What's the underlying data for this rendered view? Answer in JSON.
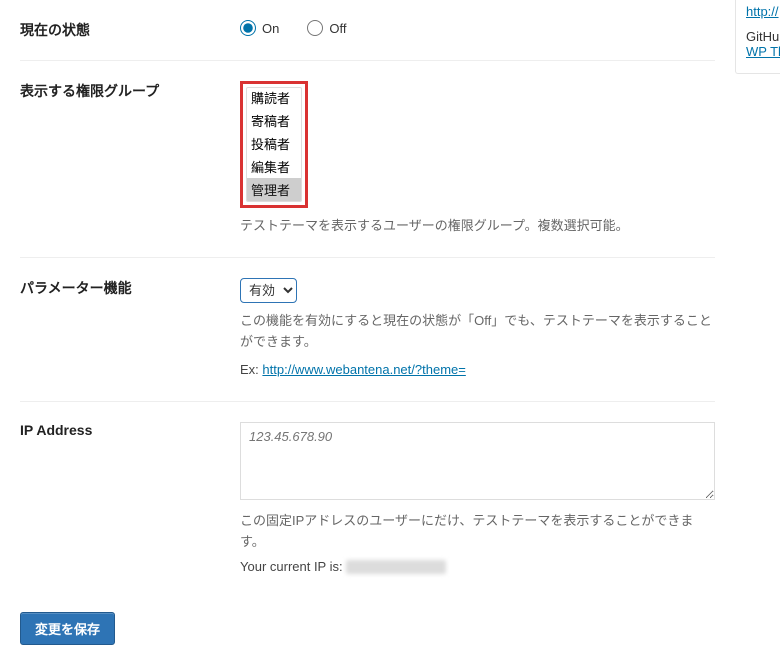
{
  "rows": {
    "status": {
      "label": "現在の状態",
      "on": "On",
      "off": "Off"
    },
    "groups": {
      "label": "表示する権限グループ",
      "options": [
        "購読者",
        "寄稿者",
        "投稿者",
        "編集者",
        "管理者"
      ],
      "selected": "管理者",
      "desc": "テストテーマを表示するユーザーの権限グループ。複数選択可能。"
    },
    "param": {
      "label": "パラメーター機能",
      "value": "有効",
      "desc": "この機能を有効にすると現在の状態が「Off」でも、テストテーマを表示することができます。",
      "ex_prefix": "Ex: ",
      "ex_link": "http://www.webantena.net/?theme="
    },
    "ip": {
      "label": "IP Address",
      "placeholder": "123.45.678.90",
      "desc": "この固定IPアドレスのユーザーにだけ、テストテーマを表示することができます。",
      "current_label": "Your current IP is: "
    }
  },
  "submit": {
    "label": "変更を保存"
  },
  "sidebar": {
    "top_link": "http://",
    "gh_label": "GitHu",
    "gh_link": "WP Th"
  }
}
